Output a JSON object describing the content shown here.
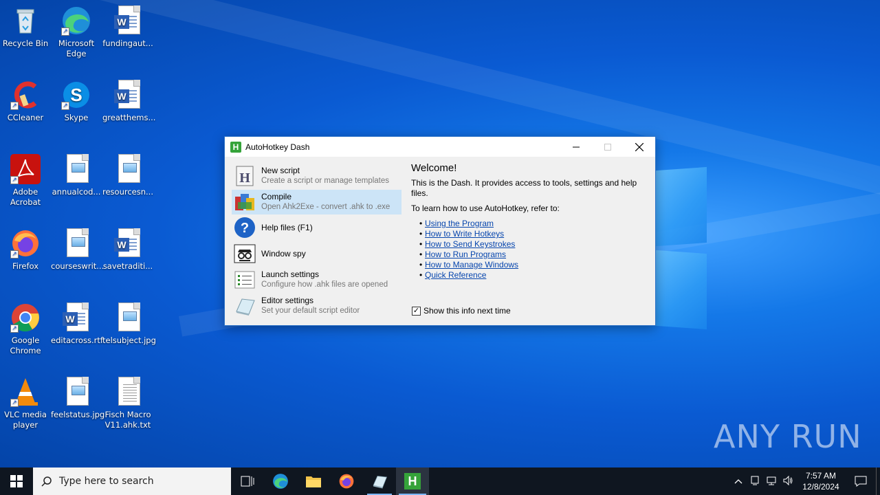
{
  "desktop": {
    "icons": [
      {
        "label": "Recycle Bin"
      },
      {
        "label": "Microsoft Edge"
      },
      {
        "label": "fundingaut..."
      },
      {
        "label": "CCleaner"
      },
      {
        "label": "Skype"
      },
      {
        "label": "greatthems..."
      },
      {
        "label": "Adobe Acrobat"
      },
      {
        "label": "annualcod..."
      },
      {
        "label": "resourcesn..."
      },
      {
        "label": "Firefox"
      },
      {
        "label": "courseswrit..."
      },
      {
        "label": "savetraditi..."
      },
      {
        "label": "Google Chrome"
      },
      {
        "label": "editacross.rtf"
      },
      {
        "label": "telsubject.jpg"
      },
      {
        "label": "VLC media player"
      },
      {
        "label": "feelstatus.jpg"
      },
      {
        "label": "Fisch Macro V11.ahk.txt"
      }
    ],
    "watermark": "ANY RUN"
  },
  "window": {
    "title": "AutoHotkey Dash",
    "items": [
      {
        "title": "New script",
        "subtitle": "Create a script or manage templates"
      },
      {
        "title": "Compile",
        "subtitle": "Open Ahk2Exe - convert .ahk to .exe"
      },
      {
        "title": "Help files (F1)",
        "subtitle": ""
      },
      {
        "title": "Window spy",
        "subtitle": ""
      },
      {
        "title": "Launch settings",
        "subtitle": "Configure how .ahk files are opened"
      },
      {
        "title": "Editor settings",
        "subtitle": "Set your default script editor"
      }
    ],
    "welcome": {
      "heading": "Welcome!",
      "intro": "This is the Dash. It provides access to tools, settings and help files.",
      "learn": "To learn how to use AutoHotkey, refer to:",
      "links": [
        "Using the Program",
        "How to Write Hotkeys",
        "How to Send Keystrokes",
        "How to Run Programs",
        "How to Manage Windows",
        "Quick Reference"
      ],
      "show_info_label": "Show this info next time",
      "show_info_checked": true
    }
  },
  "taskbar": {
    "search_placeholder": "Type here to search",
    "time": "7:57 AM",
    "date": "12/8/2024"
  },
  "colors": {
    "accent": "#2c72c7",
    "link": "#0645ad",
    "selected": "#cce4f7",
    "taskbar": "#0f1620"
  }
}
